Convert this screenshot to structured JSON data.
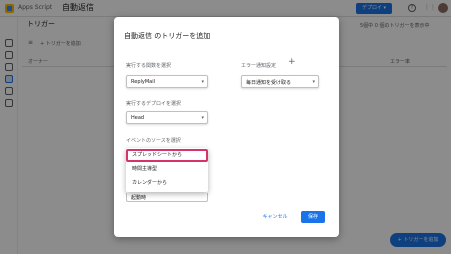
{
  "app": {
    "name": "Apps Script",
    "project": "自動返信",
    "deploy_label": "デプロイ ▾",
    "help_glyph": "?",
    "apps_glyph": "⋮⋮"
  },
  "page": {
    "title": "トリガー",
    "add_trigger": "+ トリガーを追加",
    "filter_glyph": "≡",
    "hint": "5個中 0 個のトリガーを表示中",
    "col_owner": "オーナー",
    "col_error": "エラー率",
    "fab_label": "+ トリガーを追加"
  },
  "dialog": {
    "title": "自動返信 のトリガーを追加",
    "function_label": "実行する関数を選択",
    "function_value": "ReplyMail",
    "notify_label": "エラー通知設定",
    "notify_value": "毎日通知を受け取る",
    "plus_glyph": "+",
    "deployment_label": "実行するデプロイを選択",
    "deployment_value": "Head",
    "event_source_label": "イベントのソースを選択",
    "event_options": [
      "スプレッドシートから",
      "時間主導型",
      "カレンダーから"
    ],
    "event_type_value": "起動時",
    "caret": "▾",
    "cancel_label": "キャンセル",
    "save_label": "保存"
  },
  "colors": {
    "accent": "#1a73e8",
    "highlight": "#d6336c"
  }
}
